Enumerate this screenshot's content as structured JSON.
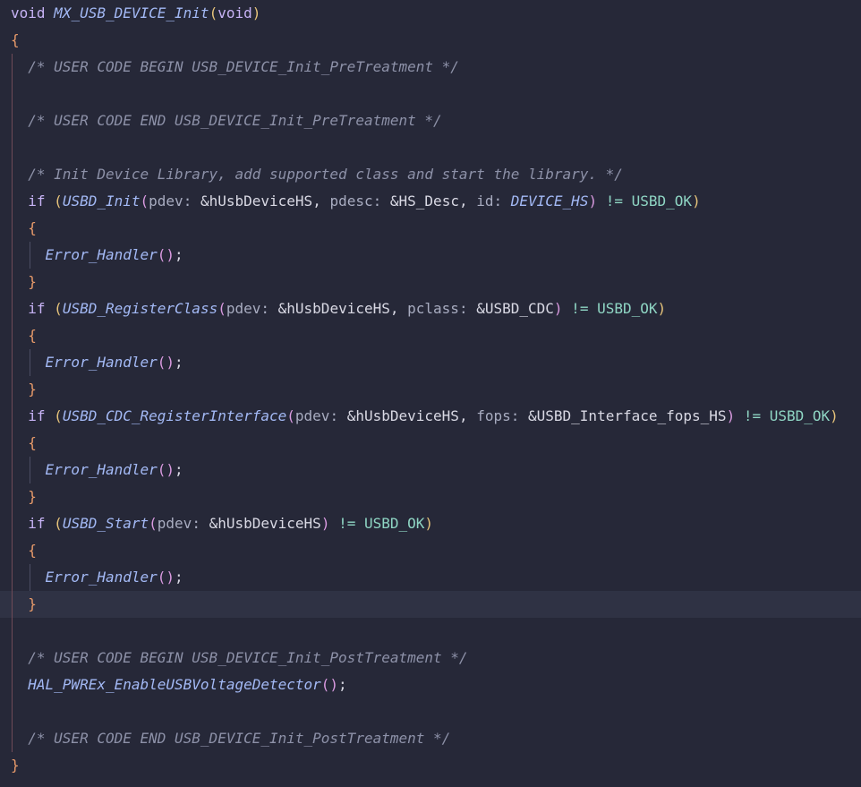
{
  "editor": {
    "lines": [
      [
        {
          "t": "void ",
          "c": "kw"
        },
        {
          "t": "MX_USB_DEVICE_Init",
          "c": "fn"
        },
        {
          "t": "(",
          "c": "paren-y"
        },
        {
          "t": "void",
          "c": "kw"
        },
        {
          "t": ")",
          "c": "paren-y"
        }
      ],
      [
        {
          "t": "{",
          "c": "brace"
        }
      ],
      [
        {
          "t": "  /* USER CODE BEGIN USB_DEVICE_Init_PreTreatment */",
          "c": "cmt"
        }
      ],
      [],
      [
        {
          "t": "  /* USER CODE END USB_DEVICE_Init_PreTreatment */",
          "c": "cmt"
        }
      ],
      [],
      [
        {
          "t": "  /* Init Device Library, add supported class and start the library. */",
          "c": "cmt"
        }
      ],
      [
        {
          "t": "  if ",
          "c": "kw"
        },
        {
          "t": "(",
          "c": "paren-y"
        },
        {
          "t": "USBD_Init",
          "c": "fn"
        },
        {
          "t": "(",
          "c": "paren-p"
        },
        {
          "t": "pdev: ",
          "c": "param"
        },
        {
          "t": "&hUsbDeviceHS",
          "c": "ref"
        },
        {
          "t": ", ",
          "c": "punc"
        },
        {
          "t": "pdesc: ",
          "c": "param"
        },
        {
          "t": "&HS_Desc",
          "c": "ref"
        },
        {
          "t": ", ",
          "c": "punc"
        },
        {
          "t": "id: ",
          "c": "param"
        },
        {
          "t": "DEVICE_HS",
          "c": "enum"
        },
        {
          "t": ")",
          "c": "paren-p"
        },
        {
          "t": " != ",
          "c": "const"
        },
        {
          "t": "USBD_OK",
          "c": "const"
        },
        {
          "t": ")",
          "c": "paren-y"
        }
      ],
      [
        {
          "t": "  {",
          "c": "brace"
        }
      ],
      [
        {
          "t": "    Error_Handler",
          "c": "fn"
        },
        {
          "t": "()",
          "c": "paren-p"
        },
        {
          "t": ";",
          "c": "punc"
        }
      ],
      [
        {
          "t": "  }",
          "c": "brace"
        }
      ],
      [
        {
          "t": "  if ",
          "c": "kw"
        },
        {
          "t": "(",
          "c": "paren-y"
        },
        {
          "t": "USBD_RegisterClass",
          "c": "fn"
        },
        {
          "t": "(",
          "c": "paren-p"
        },
        {
          "t": "pdev: ",
          "c": "param"
        },
        {
          "t": "&hUsbDeviceHS",
          "c": "ref"
        },
        {
          "t": ", ",
          "c": "punc"
        },
        {
          "t": "pclass: ",
          "c": "param"
        },
        {
          "t": "&USBD_CDC",
          "c": "ref"
        },
        {
          "t": ")",
          "c": "paren-p"
        },
        {
          "t": " != ",
          "c": "const"
        },
        {
          "t": "USBD_OK",
          "c": "const"
        },
        {
          "t": ")",
          "c": "paren-y"
        }
      ],
      [
        {
          "t": "  {",
          "c": "brace"
        }
      ],
      [
        {
          "t": "    Error_Handler",
          "c": "fn"
        },
        {
          "t": "()",
          "c": "paren-p"
        },
        {
          "t": ";",
          "c": "punc"
        }
      ],
      [
        {
          "t": "  }",
          "c": "brace"
        }
      ],
      [
        {
          "t": "  if ",
          "c": "kw"
        },
        {
          "t": "(",
          "c": "paren-y"
        },
        {
          "t": "USBD_CDC_RegisterInterface",
          "c": "fn"
        },
        {
          "t": "(",
          "c": "paren-p"
        },
        {
          "t": "pdev: ",
          "c": "param"
        },
        {
          "t": "&hUsbDeviceHS",
          "c": "ref"
        },
        {
          "t": ", ",
          "c": "punc"
        },
        {
          "t": "fops: ",
          "c": "param"
        },
        {
          "t": "&USBD_Interface_fops_HS",
          "c": "ref"
        },
        {
          "t": ")",
          "c": "paren-p"
        },
        {
          "t": " != ",
          "c": "const"
        },
        {
          "t": "USBD_OK",
          "c": "const"
        },
        {
          "t": ")",
          "c": "paren-y"
        }
      ],
      [
        {
          "t": "  {",
          "c": "brace"
        }
      ],
      [
        {
          "t": "    Error_Handler",
          "c": "fn"
        },
        {
          "t": "()",
          "c": "paren-p"
        },
        {
          "t": ";",
          "c": "punc"
        }
      ],
      [
        {
          "t": "  }",
          "c": "brace"
        }
      ],
      [
        {
          "t": "  if ",
          "c": "kw"
        },
        {
          "t": "(",
          "c": "paren-y"
        },
        {
          "t": "USBD_Start",
          "c": "fn"
        },
        {
          "t": "(",
          "c": "paren-p"
        },
        {
          "t": "pdev: ",
          "c": "param"
        },
        {
          "t": "&hUsbDeviceHS",
          "c": "ref"
        },
        {
          "t": ")",
          "c": "paren-p"
        },
        {
          "t": " != ",
          "c": "const"
        },
        {
          "t": "USBD_OK",
          "c": "const"
        },
        {
          "t": ")",
          "c": "paren-y"
        }
      ],
      [
        {
          "t": "  {",
          "c": "brace"
        }
      ],
      [
        {
          "t": "    Error_Handler",
          "c": "fn"
        },
        {
          "t": "()",
          "c": "paren-p"
        },
        {
          "t": ";",
          "c": "punc"
        }
      ],
      [
        {
          "t": "  }",
          "c": "brace"
        }
      ],
      [],
      [
        {
          "t": "  /* USER CODE BEGIN USB_DEVICE_Init_PostTreatment */",
          "c": "cmt"
        }
      ],
      [
        {
          "t": "  HAL_PWREx_EnableUSBVoltageDetector",
          "c": "fn"
        },
        {
          "t": "()",
          "c": "paren-p"
        },
        {
          "t": ";",
          "c": "punc"
        }
      ],
      [],
      [
        {
          "t": "  /* USER CODE END USB_DEVICE_Init_PostTreatment */",
          "c": "cmt"
        }
      ],
      [
        {
          "t": "}",
          "c": "brace"
        }
      ]
    ]
  },
  "theme": {
    "background": "#262838",
    "current_line": "#2f3244"
  }
}
